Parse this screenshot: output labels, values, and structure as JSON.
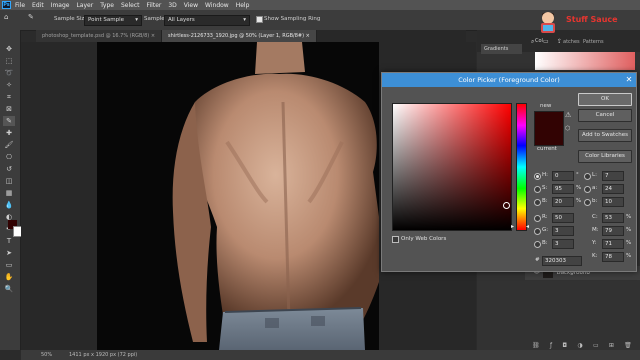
{
  "app": {
    "menu": [
      "File",
      "Edit",
      "Image",
      "Layer",
      "Type",
      "Select",
      "Filter",
      "3D",
      "View",
      "Window",
      "Help"
    ],
    "logo_text": "Ps"
  },
  "options": {
    "sample_size_label": "Sample Size:",
    "sample_size_value": "Point Sample",
    "sample_label": "Sample:",
    "sample_value": "All Layers",
    "show_ring_label": "Show Sampling Ring"
  },
  "tabs": [
    {
      "label": "photoshop_template.psd @ 16.7% (RGB/8)",
      "active": false
    },
    {
      "label": "shirtless-2126733_1920.jpg @ 50% (Layer 1, RGB/8#)",
      "active": true
    }
  ],
  "brand": {
    "text": "Stuff Sauce",
    "color": "#e8352f"
  },
  "right_panel": {
    "gradients_label": "Gradients",
    "tab_color": "Col",
    "tab_swatches": "atches",
    "tab_patterns": "Patterns",
    "layer_name": "Background"
  },
  "status": {
    "zoom": "50%",
    "doc_info": "1411 px x 1920 px (72 ppi)"
  },
  "color_picker": {
    "title": "Color Picker (Foreground Color)",
    "ok_label": "OK",
    "cancel_label": "Cancel",
    "add_swatches_label": "Add to Swatches",
    "color_libraries_label": "Color Libraries",
    "new_label": "new",
    "current_label": "current",
    "only_web_label": "Only Web Colors",
    "new_color": "#320303",
    "current_color": "#320303",
    "hue_color": "#ff0000",
    "hsb": {
      "H": "0",
      "S": "95",
      "B": "20",
      "H_unit": "°",
      "S_unit": "%",
      "B_unit": "%"
    },
    "rgb": {
      "R": "50",
      "G": "3",
      "B": "3"
    },
    "lab": {
      "L": "7",
      "a": "24",
      "b": "10"
    },
    "cmyk": {
      "C": "53",
      "M": "79",
      "Y": "71",
      "K": "78"
    },
    "percent": "%",
    "hex_label": "#",
    "hex": "320303"
  },
  "toolbar": {
    "foreground": "#320303",
    "background": "#ffffff"
  }
}
